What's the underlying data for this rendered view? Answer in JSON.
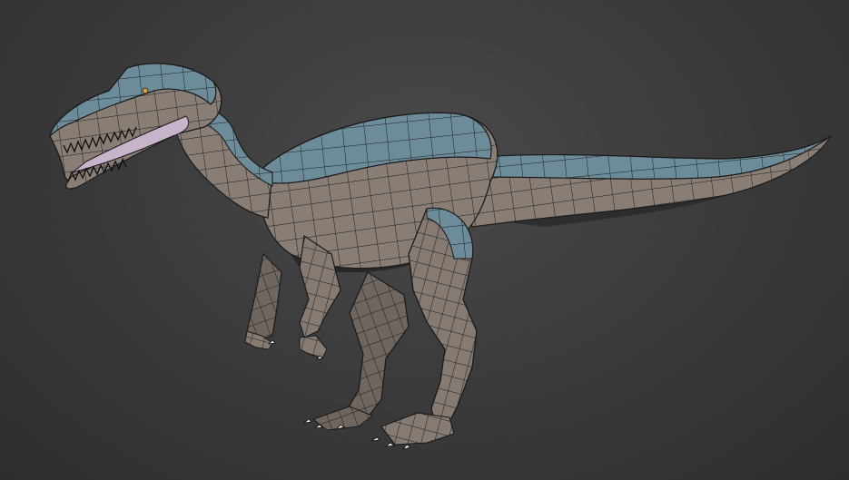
{
  "viewport": {
    "subject": "dinosaur-wireframe-model"
  },
  "colors": {
    "background": "#3a3a3a",
    "body_gray": "#8a8078",
    "body_gray_dark": "#6e665f",
    "back_blue": "#6f8e9c",
    "mouth_pink": "#c8b4cc",
    "wire": "#1a1a1a",
    "claw": "#e8e8e8",
    "eye": "#d8a040"
  }
}
